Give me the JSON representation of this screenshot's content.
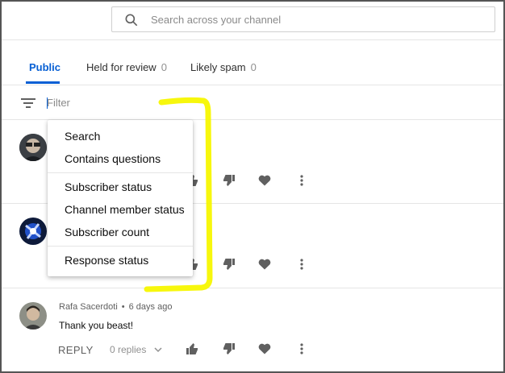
{
  "search": {
    "placeholder": "Search across your channel"
  },
  "tabs": [
    {
      "label": "Public",
      "count": ""
    },
    {
      "label": "Held for review",
      "count": "0"
    },
    {
      "label": "Likely spam",
      "count": "0"
    }
  ],
  "filter": {
    "placeholder": "Filter"
  },
  "filter_menu": {
    "items": [
      "Search",
      "Contains questions",
      "Subscriber status",
      "Channel member status",
      "Subscriber count",
      "Response status"
    ]
  },
  "comments": [
    {
      "author": "",
      "time": "",
      "text": ""
    },
    {
      "author": "",
      "time": "",
      "text": ""
    },
    {
      "author": "Rafa Sacerdoti",
      "separator": "•",
      "time": "6 days ago",
      "text": "Thank you beast!",
      "reply_label": "REPLY",
      "replies_label": "0 replies"
    }
  ],
  "colors": {
    "accent": "#065fd4",
    "highlight": "#f7f700",
    "icon": "#606060"
  }
}
